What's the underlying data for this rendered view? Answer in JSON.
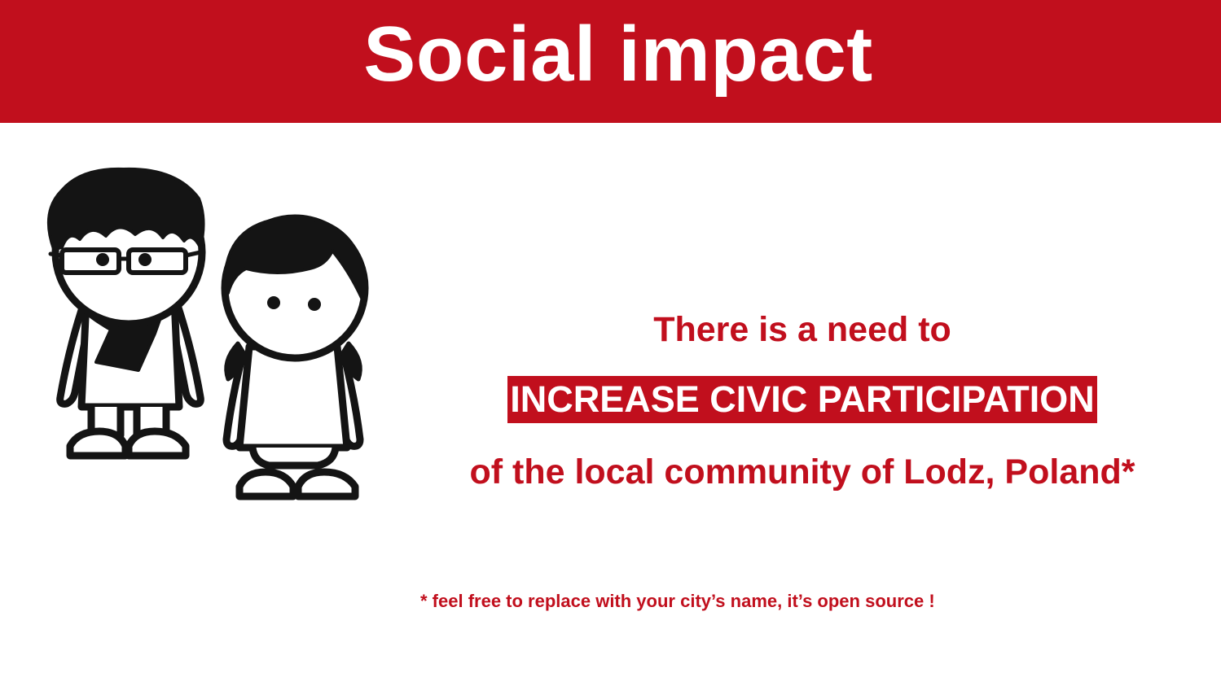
{
  "header": {
    "title": "Social impact",
    "background_color": "#c10f1d"
  },
  "illustration": {
    "characters": [
      "boy-with-glasses-and-scarf",
      "girl-with-pigtails"
    ]
  },
  "body": {
    "line1": "There is a need to",
    "highlight": "INCREASE CIVIC PARTICIPATION",
    "line3": "of the local community of Lodz, Poland*",
    "footnote": "* feel free to replace with your city’s name, it’s open source !",
    "text_color": "#c10f1d"
  }
}
